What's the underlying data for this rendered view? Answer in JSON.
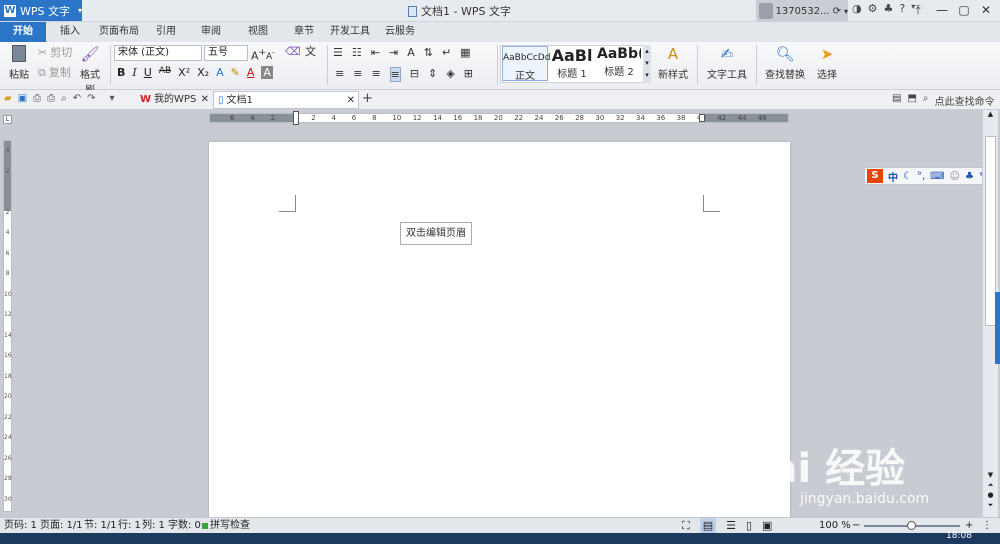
{
  "app": {
    "brand": "WPS 文字",
    "window_title": "文档1 - WPS 文字",
    "account": "1370532..."
  },
  "tabs": [
    "开始",
    "插入",
    "页面布局",
    "引用",
    "审阅",
    "视图",
    "章节",
    "开发工具",
    "云服务"
  ],
  "active_tab": "开始",
  "ribbon": {
    "paste": "粘贴",
    "cut": "剪切",
    "copy": "复制",
    "format_painter": "格式刷",
    "font_name": "宋体 (正文)",
    "font_size": "五号",
    "styles": [
      {
        "preview": "AaBbCcDd",
        "label": "正文"
      },
      {
        "preview": "AaBl",
        "label": "标题 1"
      },
      {
        "preview": "AaBb(",
        "label": "标题 2"
      }
    ],
    "new_style": "新样式",
    "text_tools": "文字工具",
    "find_replace": "查找替换",
    "select": "选择"
  },
  "quickbar": {
    "doc_tabs": [
      "我的WPS",
      "文档1"
    ],
    "search_command": "点此查找命令"
  },
  "ruler_ticks": [
    "6",
    "4",
    "2",
    "",
    "2",
    "4",
    "6",
    "8",
    "10",
    "12",
    "14",
    "16",
    "18",
    "20",
    "22",
    "24",
    "26",
    "28",
    "30",
    "32",
    "34",
    "36",
    "38",
    "40",
    "42",
    "44",
    "46"
  ],
  "vruler_ticks": [
    "4",
    "2",
    "",
    "2",
    "4",
    "6",
    "8",
    "10",
    "12",
    "14",
    "16",
    "18",
    "20",
    "22",
    "24",
    "26",
    "28",
    "30"
  ],
  "page": {
    "header_hint": "双击编辑页眉"
  },
  "ime_label": "中",
  "statusbar": {
    "page": "页码: 1",
    "pages": "页面: 1/1",
    "section": "节: 1/1",
    "line": "行: 1",
    "column": "列: 1",
    "words": "字数: 0",
    "spell_check": "拼写检查",
    "zoom": "100 %"
  },
  "taskbar_time": "18:08",
  "watermark": {
    "brand": "Bai 经验",
    "url": "jingyan.baidu.com"
  }
}
